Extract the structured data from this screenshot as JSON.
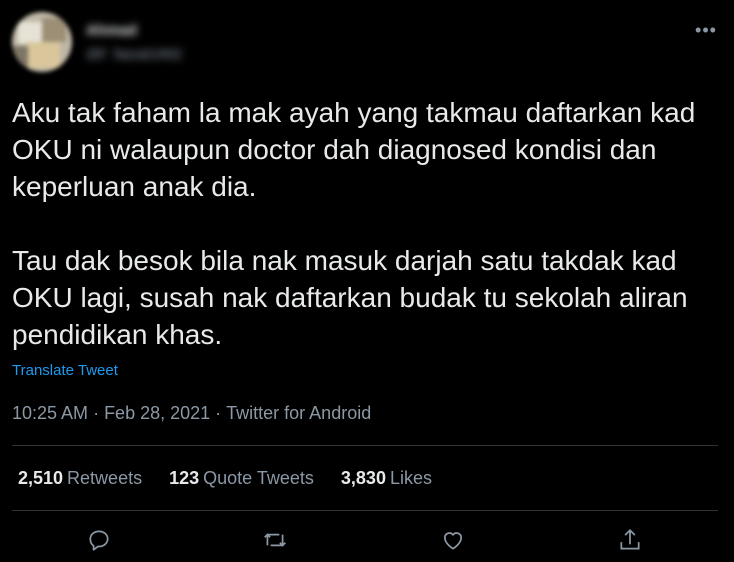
{
  "author": {
    "display_name": "Ahmad",
    "handle": "@f_faizal1992"
  },
  "tweet": {
    "text": "Aku tak faham la mak ayah yang takmau daftarkan kad\nOKU ni walaupun doctor dah diagnosed kondisi dan\nkeperluan anak dia.\n\nTau dak besok bila nak masuk darjah satu takdak kad\nOKU lagi, susah nak daftarkan budak tu sekolah aliran\npendidikan khas.",
    "translate_label": "Translate Tweet",
    "time": "10:25 AM",
    "date": "Feb 28, 2021",
    "source": "Twitter for Android",
    "separator": "·"
  },
  "stats": {
    "retweets_count": "2,510",
    "retweets_label": "Retweets",
    "quotes_count": "123",
    "quotes_label": "Quote Tweets",
    "likes_count": "3,830",
    "likes_label": "Likes"
  },
  "icons": {
    "more": "more-icon",
    "reply": "reply-icon",
    "retweet": "retweet-icon",
    "like": "like-icon",
    "share": "share-icon"
  },
  "colors": {
    "background": "#000000",
    "text": "#e7e9ea",
    "secondary": "#8b98a5",
    "link": "#1d9bf0",
    "divider": "#2f3336"
  }
}
